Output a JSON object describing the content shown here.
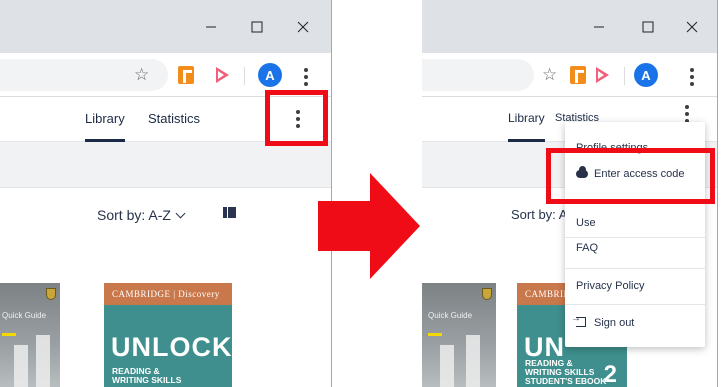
{
  "left": {
    "tabs": [
      {
        "label": "Library",
        "active": true
      },
      {
        "label": "Statistics",
        "active": false
      }
    ],
    "avatar_letter": "A",
    "sort_label": "Sort by: A-Z",
    "book_grey_text": "Quick Guide",
    "book_unlock": {
      "publisher": "CAMBRIDGE | Discovery",
      "title": "UNLOCK",
      "subtitle_lines": [
        "READING &",
        "WRITING SKILLS"
      ]
    }
  },
  "right": {
    "tabs": [
      {
        "label": "Library",
        "active": true
      },
      {
        "label": "Statistics",
        "active": false
      }
    ],
    "avatar_letter": "A",
    "sort_label": "Sort by: A",
    "book_grey_text": "Quick Guide",
    "book_unlock": {
      "publisher": "CAMBRIDGE",
      "title": "UN",
      "subtitle_lines": [
        "READING &",
        "WRITING SKILLS",
        "STUDENT'S EBOOK"
      ],
      "level": "2"
    },
    "menu": {
      "items": [
        {
          "label": "Profile settings"
        },
        {
          "label": "Enter access code",
          "icon": "cloud-upload-icon",
          "highlighted": true
        },
        {
          "label": "Use"
        },
        {
          "label": "FAQ"
        },
        {
          "label": "Privacy Policy"
        },
        {
          "label": "Sign out",
          "icon": "sign-out-icon"
        }
      ]
    }
  },
  "colors": {
    "highlight": "#ef0c16",
    "arrow": "#ef0c16",
    "accent": "#1b2a45",
    "avatar": "#1a73e8"
  }
}
